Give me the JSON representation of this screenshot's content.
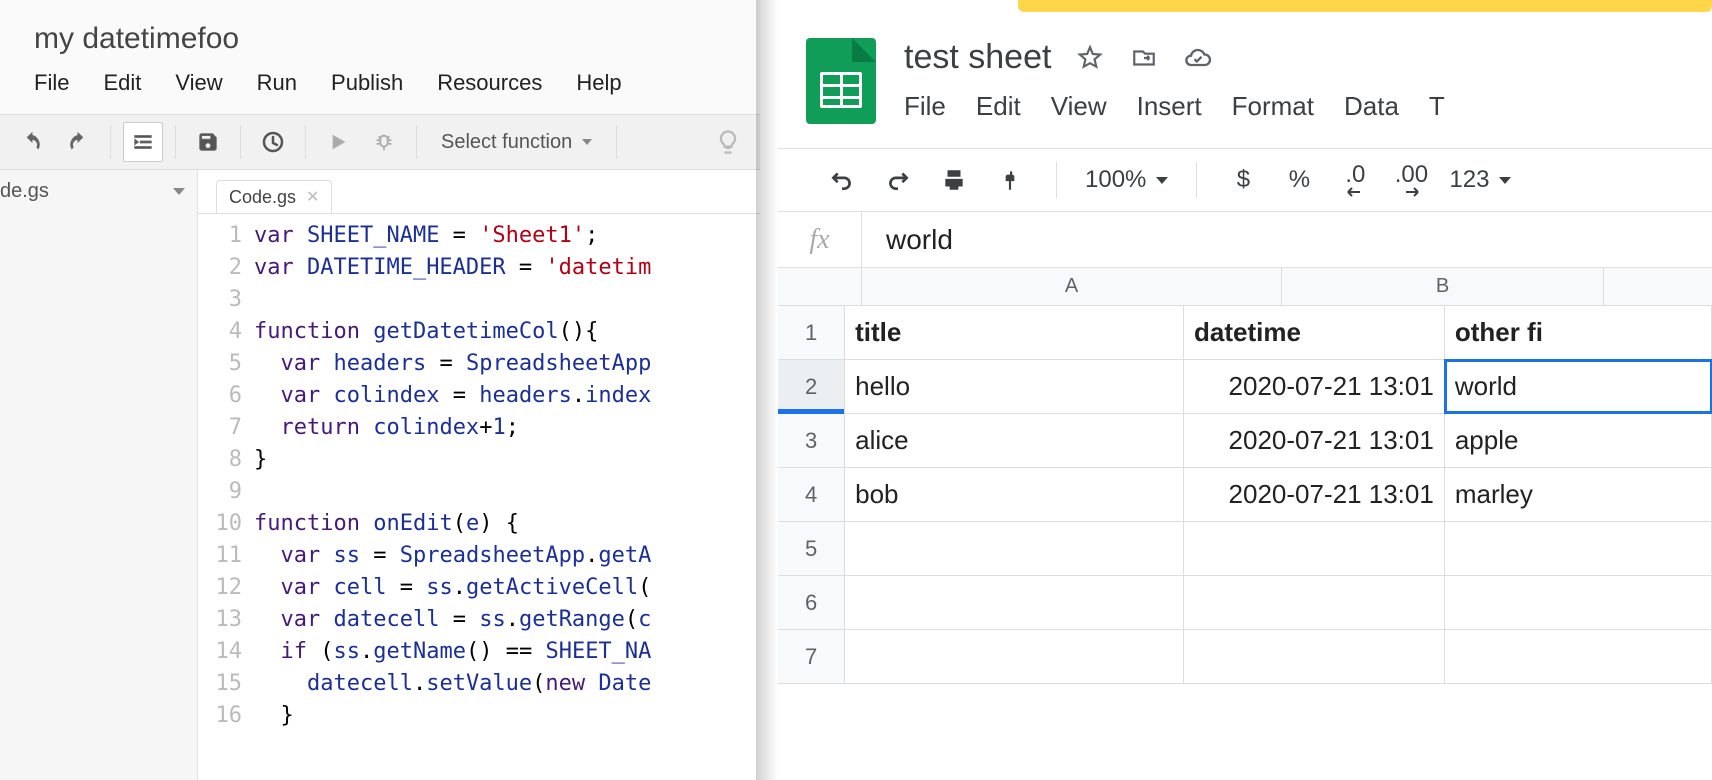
{
  "editor": {
    "title": "my datetimefoo",
    "menu": {
      "file": "File",
      "edit": "Edit",
      "view": "View",
      "run": "Run",
      "publish": "Publish",
      "resources": "Resources",
      "help": "Help"
    },
    "toolbar": {
      "select_function": "Select function"
    },
    "sidebar": {
      "file_name": "de.gs"
    },
    "tab": {
      "name": "Code.gs"
    },
    "code": {
      "gutter": [
        "1",
        "2",
        "3",
        "4",
        "5",
        "6",
        "7",
        "8",
        "9",
        "10",
        "11",
        "12",
        "13",
        "14",
        "15",
        "16"
      ],
      "lines": [
        {
          "tokens": [
            {
              "t": "var ",
              "c": "kw"
            },
            {
              "t": "SHEET_NAME",
              "c": "id"
            },
            {
              "t": " = "
            },
            {
              "t": "'Sheet1'",
              "c": "str"
            },
            {
              "t": ";"
            }
          ]
        },
        {
          "tokens": [
            {
              "t": "var ",
              "c": "kw"
            },
            {
              "t": "DATETIME_HEADER",
              "c": "id"
            },
            {
              "t": " = "
            },
            {
              "t": "'datetim",
              "c": "str"
            }
          ]
        },
        {
          "tokens": []
        },
        {
          "tokens": [
            {
              "t": "function ",
              "c": "kw"
            },
            {
              "t": "getDatetimeCol",
              "c": "id"
            },
            {
              "t": "(){"
            }
          ]
        },
        {
          "tokens": [
            {
              "t": "  "
            },
            {
              "t": "var ",
              "c": "kw"
            },
            {
              "t": "headers",
              "c": "id"
            },
            {
              "t": " = "
            },
            {
              "t": "SpreadsheetApp",
              "c": "id"
            }
          ]
        },
        {
          "tokens": [
            {
              "t": "  "
            },
            {
              "t": "var ",
              "c": "kw"
            },
            {
              "t": "colindex",
              "c": "id"
            },
            {
              "t": " = "
            },
            {
              "t": "headers",
              "c": "id"
            },
            {
              "t": "."
            },
            {
              "t": "index",
              "c": "id"
            }
          ]
        },
        {
          "tokens": [
            {
              "t": "  "
            },
            {
              "t": "return ",
              "c": "kw"
            },
            {
              "t": "colindex",
              "c": "id"
            },
            {
              "t": "+"
            },
            {
              "t": "1",
              "c": "num"
            },
            {
              "t": ";"
            }
          ]
        },
        {
          "tokens": [
            {
              "t": "}"
            }
          ]
        },
        {
          "tokens": []
        },
        {
          "tokens": [
            {
              "t": "function ",
              "c": "kw"
            },
            {
              "t": "onEdit",
              "c": "id"
            },
            {
              "t": "("
            },
            {
              "t": "e",
              "c": "id"
            },
            {
              "t": ") {"
            }
          ]
        },
        {
          "tokens": [
            {
              "t": "  "
            },
            {
              "t": "var ",
              "c": "kw"
            },
            {
              "t": "ss",
              "c": "id"
            },
            {
              "t": " = "
            },
            {
              "t": "SpreadsheetApp",
              "c": "id"
            },
            {
              "t": "."
            },
            {
              "t": "getA",
              "c": "id"
            }
          ]
        },
        {
          "tokens": [
            {
              "t": "  "
            },
            {
              "t": "var ",
              "c": "kw"
            },
            {
              "t": "cell",
              "c": "id"
            },
            {
              "t": " = "
            },
            {
              "t": "ss",
              "c": "id"
            },
            {
              "t": "."
            },
            {
              "t": "getActiveCell",
              "c": "id"
            },
            {
              "t": "("
            }
          ]
        },
        {
          "tokens": [
            {
              "t": "  "
            },
            {
              "t": "var ",
              "c": "kw"
            },
            {
              "t": "datecell",
              "c": "id"
            },
            {
              "t": " = "
            },
            {
              "t": "ss",
              "c": "id"
            },
            {
              "t": "."
            },
            {
              "t": "getRange",
              "c": "id"
            },
            {
              "t": "("
            },
            {
              "t": "c",
              "c": "id"
            }
          ]
        },
        {
          "tokens": [
            {
              "t": "  "
            },
            {
              "t": "if ",
              "c": "kw"
            },
            {
              "t": "("
            },
            {
              "t": "ss",
              "c": "id"
            },
            {
              "t": "."
            },
            {
              "t": "getName",
              "c": "id"
            },
            {
              "t": "() == "
            },
            {
              "t": "SHEET_NA",
              "c": "id"
            }
          ]
        },
        {
          "tokens": [
            {
              "t": "    "
            },
            {
              "t": "datecell",
              "c": "id"
            },
            {
              "t": "."
            },
            {
              "t": "setValue",
              "c": "id"
            },
            {
              "t": "("
            },
            {
              "t": "new ",
              "c": "kw"
            },
            {
              "t": "Date",
              "c": "id"
            }
          ]
        },
        {
          "tokens": [
            {
              "t": "  }"
            }
          ]
        }
      ]
    }
  },
  "sheets": {
    "title": "test sheet",
    "menu": {
      "file": "File",
      "edit": "Edit",
      "view": "View",
      "insert": "Insert",
      "format": "Format",
      "data": "Data",
      "t": "T"
    },
    "toolbar": {
      "zoom": "100%",
      "currency": "$",
      "percent": "%",
      "dec_dec": ".0",
      "inc_dec": ".00",
      "more": "123"
    },
    "formula": {
      "fx": "fx",
      "value": "world"
    },
    "columns": [
      "A",
      "B"
    ],
    "rows": [
      {
        "num": "1",
        "cells": [
          "title",
          "datetime",
          "other fi"
        ],
        "bold": true
      },
      {
        "num": "2",
        "cells": [
          "hello",
          "2020-07-21 13:01",
          "world"
        ],
        "selected_col": 2
      },
      {
        "num": "3",
        "cells": [
          "alice",
          "2020-07-21 13:01",
          "apple"
        ]
      },
      {
        "num": "4",
        "cells": [
          "bob",
          "2020-07-21 13:01",
          "marley"
        ]
      },
      {
        "num": "5",
        "cells": [
          "",
          "",
          ""
        ]
      },
      {
        "num": "6",
        "cells": [
          "",
          "",
          ""
        ]
      },
      {
        "num": "7",
        "cells": [
          "",
          "",
          ""
        ]
      }
    ]
  }
}
